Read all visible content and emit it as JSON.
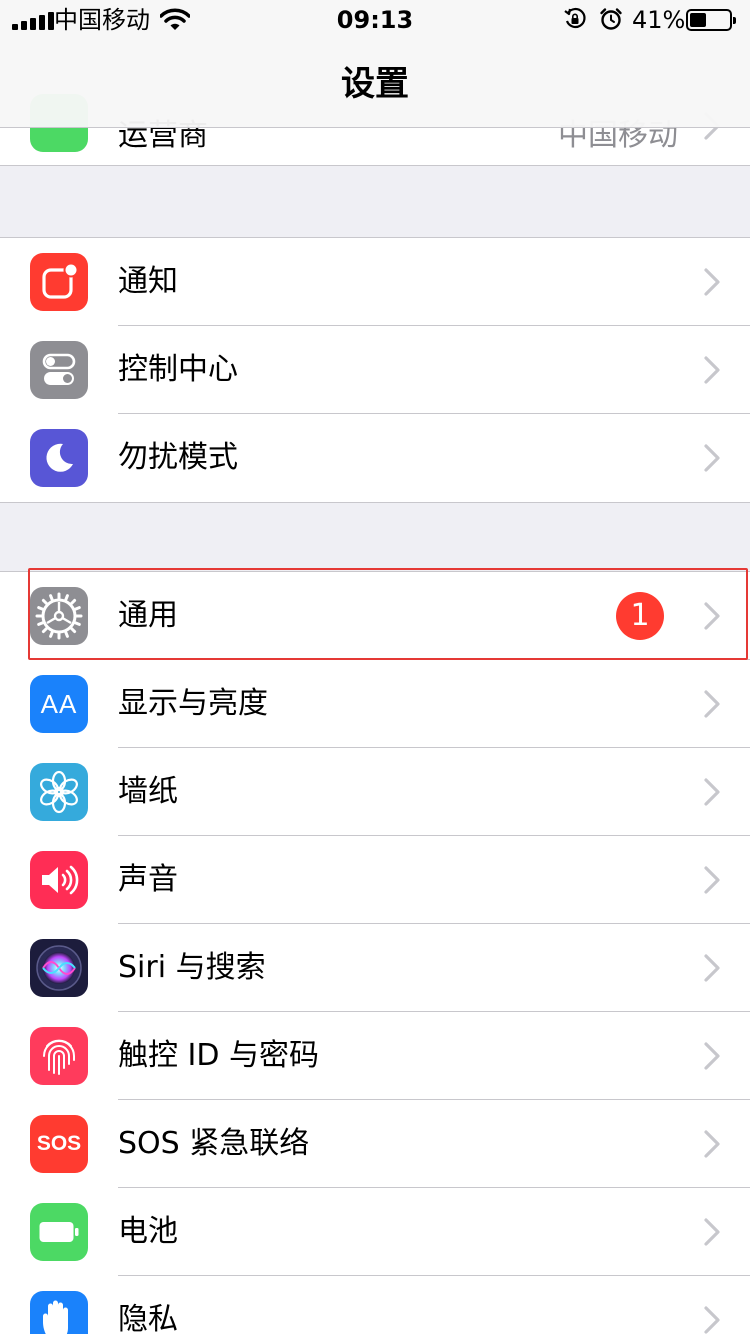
{
  "status_bar": {
    "carrier": "中国移动",
    "time": "09:13",
    "battery_percent": "41%",
    "battery_level": 0.41,
    "icons": [
      "signal-icon",
      "wifi-icon",
      "rotation-lock-icon",
      "alarm-icon",
      "battery-icon"
    ]
  },
  "nav": {
    "title": "设置"
  },
  "peek_row": {
    "label": "运营商",
    "detail": "中国移动",
    "icon": "phone-icon",
    "color": "#4cd964"
  },
  "group1": {
    "items": [
      {
        "label": "通知",
        "icon": "notifications-icon",
        "color": "#ff3b30"
      },
      {
        "label": "控制中心",
        "icon": "control-center-icon",
        "color": "#8e8e93"
      },
      {
        "label": "勿扰模式",
        "icon": "moon-icon",
        "color": "#5856d6"
      }
    ]
  },
  "group2": {
    "items": [
      {
        "label": "通用",
        "icon": "gear-icon",
        "color": "#8e8e93",
        "badge": "1"
      },
      {
        "label": "显示与亮度",
        "icon": "display-brightness-icon",
        "color": "#1a82fb",
        "icon_text": "AA"
      },
      {
        "label": "墙纸",
        "icon": "wallpaper-flower-icon",
        "color": "#35aadc"
      },
      {
        "label": "声音",
        "icon": "speaker-icon",
        "color": "#ff2d55"
      },
      {
        "label": "Siri 与搜索",
        "icon": "siri-icon",
        "color": "#1c1c3c"
      },
      {
        "label": "触控 ID 与密码",
        "icon": "fingerprint-icon",
        "color": "#ff3b5c"
      },
      {
        "label": "SOS 紧急联络",
        "icon": "sos-icon",
        "color": "#ff3b30",
        "icon_text": "SOS"
      },
      {
        "label": "电池",
        "icon": "battery-icon",
        "color": "#4cd964"
      },
      {
        "label": "隐私",
        "icon": "hand-icon",
        "color": "#1a82fb"
      }
    ]
  },
  "colors": {
    "background": "#efeff4",
    "separator": "#c8c7cc",
    "chevron": "#c7c7cc",
    "highlight": "#e53935"
  }
}
